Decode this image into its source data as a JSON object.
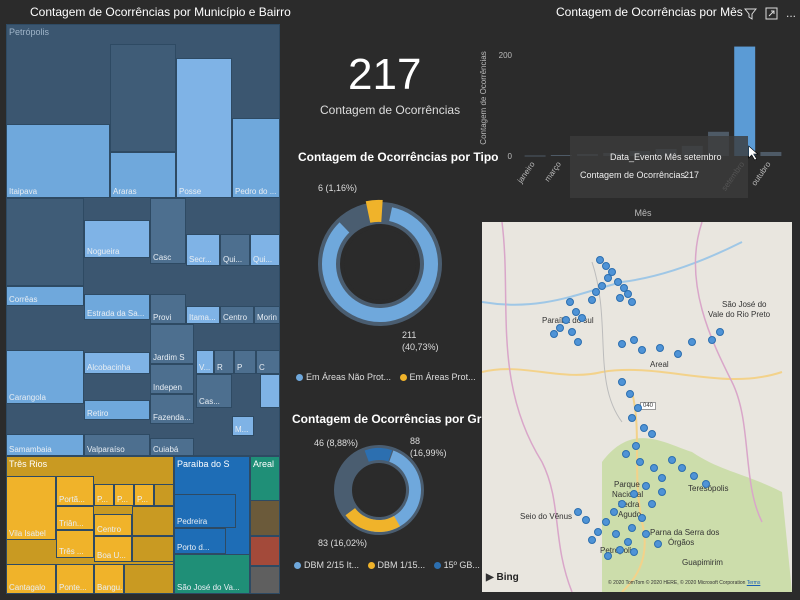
{
  "treemap": {
    "title": "Contagem de Ocorrências por Município e Bairro",
    "groups": {
      "petropolis": "Petrópolis",
      "tres_rios": "Três Rios",
      "paraiba": "Paraíba do S",
      "areal": "Areal"
    },
    "cells": {
      "itaipava": "Itaipava",
      "araras": "Araras",
      "posse": "Posse",
      "pedro": "Pedro do ...",
      "nogueira": "Nogueira",
      "correas": "Corrêas",
      "estrada": "Estrada da Sa...",
      "casc": "Casc",
      "secr": "Secr...",
      "qui1": "Qui...",
      "qui2": "Qui...",
      "provi": "Provi",
      "itama": "Itama...",
      "centro1": "Centro",
      "morin": "Morin",
      "alcobacinha": "Alcobacinha",
      "jardim": "Jardim S",
      "v": "V...",
      "r": "R",
      "p": "P",
      "c": "C",
      "carangola": "Carangola",
      "retiro": "Retiro",
      "indepen": "Indepen",
      "cas": "Cas...",
      "fazenda": "Fazenda...",
      "m": "M...",
      "samambaia": "Samambaia",
      "valparaiso": "Valparaíso",
      "cuiaba": "Cuiabá",
      "porta": "Portã...",
      "p1": "P...",
      "p2": "P...",
      "p3": "P...",
      "vila": "Vila Isabel",
      "trian": "Triân...",
      "centro2": "Centro",
      "tres": "Três ...",
      "boa": "Boa U...",
      "cantagalo": "Cantagalo",
      "ponte": "Ponte...",
      "bangu": "Bangu...",
      "pedreira": "Pedreira",
      "porto": "Porto d...",
      "sao_jose": "São José do Va..."
    }
  },
  "card": {
    "value": "217",
    "label": "Contagem de Ocorrências"
  },
  "donut_tipo": {
    "title": "Contagem de Ocorrências por Tipo",
    "label_small": "6 (1,16%)",
    "label_large_1": "211",
    "label_large_2": "(40,73%)",
    "legend": [
      "Em Áreas Não Prot...",
      "Em Áreas Prot..."
    ],
    "colors": [
      "#6fa8dc",
      "#f0b32a"
    ]
  },
  "donut_grupo": {
    "title": "Contagem de Ocorrências por Grupo",
    "label_left": "46 (8,88%)",
    "label_right_1": "88",
    "label_right_2": "(16,99%)",
    "label_bottom": "83 (16,02%)",
    "legend": [
      "DBM 2/15 It...",
      "DBM 1/15...",
      "15º GB..."
    ],
    "colors": [
      "#6fa8dc",
      "#f0b32a",
      "#2c6fb0"
    ]
  },
  "chart_data": {
    "type": "bar",
    "title": "Contagem de Ocorrências por Mês",
    "xlabel": "Mês",
    "ylabel": "Contagem de Ocorrências",
    "categories": [
      "janeiro",
      "março",
      "",
      "",
      "",
      "",
      "",
      "",
      "setembro",
      "outubro"
    ],
    "values": [
      1,
      2,
      4,
      6,
      10,
      14,
      20,
      48,
      217,
      8
    ],
    "yticks": [
      0,
      200
    ],
    "ylim": [
      0,
      230
    ],
    "highlight_index": 8,
    "colors": {
      "bar": "#4e5a66",
      "highlight": "#5b9bd5"
    }
  },
  "tooltip": {
    "row1_key": "Data_Evento Mês",
    "row1_val": "setembro",
    "row2_key": "Contagem de Ocorrências",
    "row2_val": "217"
  },
  "toolbar": {
    "filter_icon": "filter-icon",
    "focus_icon": "focus-mode-icon",
    "more": "..."
  },
  "map": {
    "labels": {
      "paraiba": "Paraíba do sul",
      "sao_jose_1": "São José do",
      "sao_jose_2": "Vale do Rio Preto",
      "areal": "Areal",
      "teresopolis": "Teresópolis",
      "petropolis": "Petrópolis",
      "seio": "Seio do Vênus",
      "parque_1": "Parque",
      "parque_2": "Nacional",
      "parque_3": "Pedra",
      "parque_4": "Agudo",
      "serra_1": "Parna da Serra dos",
      "serra_2": "Órgãos",
      "guapimirim": "Guapimirim",
      "road": "040",
      "bing": "Bing",
      "copyright": "© 2020 TomTom © 2020 HERE, © 2020 Microsoft Corporation",
      "terms": "Terms"
    }
  }
}
